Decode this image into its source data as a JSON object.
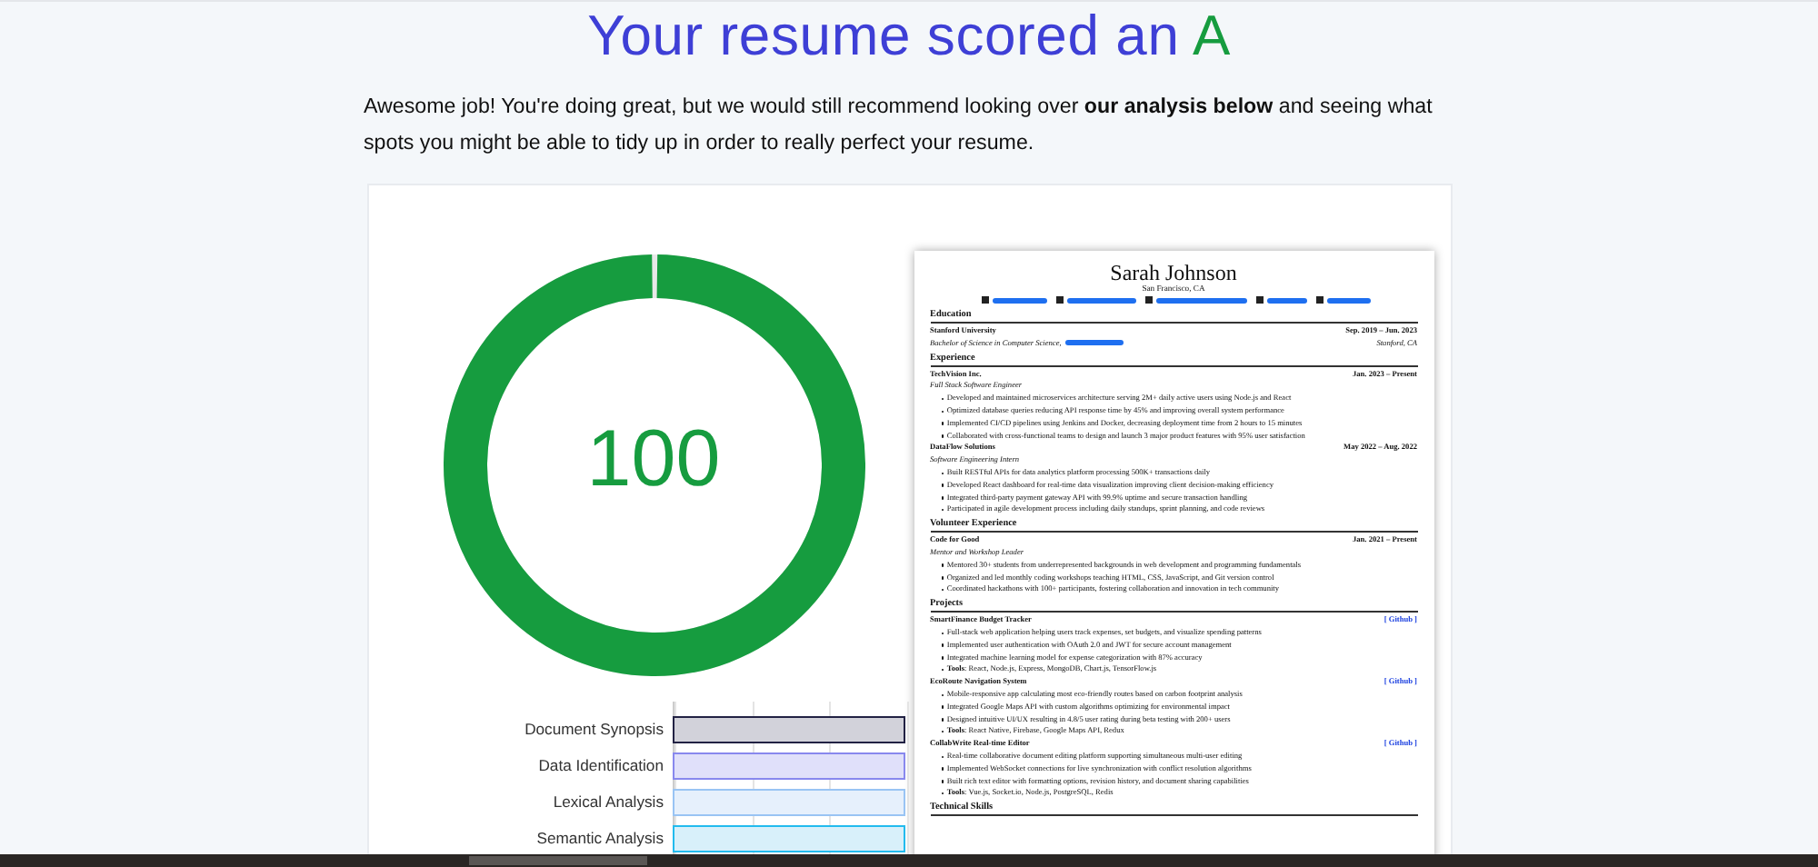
{
  "heading": {
    "text": "Your resume scored an",
    "grade": "A"
  },
  "intro": "Awesome job! You're doing great, but we would still recommend looking over **our analysis below** and seeing what spots you might be able to tidy up in order to really perfect your resume.",
  "score": {
    "value": "100",
    "level": 1
  },
  "analysis": [
    {
      "label": "Document Synopsis",
      "color": "#d2d2da"
    },
    {
      "label": "Data Identification",
      "color": "#e0e0fa"
    },
    {
      "label": "Lexical Analysis",
      "color": "#e6f0fc"
    },
    {
      "label": "Semantic Analysis",
      "color": "#d8f0fa"
    }
  ],
  "resume": {
    "name": "Sarah Johnson",
    "location": "San Francisco, CA",
    "sections": [
      {
        "heading": "Education",
        "entries": [
          {
            "title": "Stanford University",
            "date": "Sep. 2019 – Jun. 2023",
            "subtitle": "Bachelor of Science in Computer Science,",
            "redacted": true,
            "place": "Stanford, CA"
          }
        ]
      },
      {
        "heading": "Experience",
        "entries": [
          {
            "title": "TechVision Inc.",
            "date": "Jan. 2023 – Present",
            "subtitle": "Full Stack Software Engineer",
            "bullets": [
              "Developed and maintained microservices architecture serving 2M+ daily active users using Node.js and React",
              "Optimized database queries reducing API response time by 45% and improving overall system performance",
              "Implemented CI/CD pipelines using Jenkins and Docker, decreasing deployment time from 2 hours to 15 minutes",
              "Collaborated with cross-functional teams to design and launch 3 major product features with 95% user satisfaction"
            ]
          },
          {
            "title": "DataFlow Solutions",
            "date": "May 2022 – Aug. 2022",
            "subtitle": "Software Engineering Intern",
            "bullets": [
              "Built RESTful APIs for data analytics platform processing 500K+ transactions daily",
              "Developed React dashboard for real-time data visualization improving client decision-making efficiency",
              "Integrated third-party payment gateway API with 99.9% uptime and secure transaction handling",
              "Participated in agile development process including daily standups, sprint planning, and code reviews"
            ]
          }
        ]
      },
      {
        "heading": "Volunteer Experience",
        "entries": [
          {
            "title": "Code for Good",
            "date": "Jan. 2021 – Present",
            "subtitle": "Mentor and Workshop Leader",
            "bullets": [
              "Mentored 30+ students from underrepresented backgrounds in web development and programming fundamentals",
              "Organized and led monthly coding workshops teaching HTML, CSS, JavaScript, and Git version control",
              "Coordinated hackathons with 100+ participants, fostering collaboration and innovation in tech community"
            ]
          }
        ]
      },
      {
        "heading": "Projects",
        "entries": [
          {
            "title": "SmartFinance Budget Tracker",
            "link": "[ Github ]",
            "bullets": [
              "Full-stack web application helping users track expenses, set budgets, and visualize spending patterns",
              "Implemented user authentication with OAuth 2.0 and JWT for secure account management",
              "Integrated machine learning model for expense categorization with 87% accuracy",
              "**Tools**: React, Node.js, Express, MongoDB, Chart.js, TensorFlow.js"
            ]
          },
          {
            "title": "EcoRoute Navigation System",
            "link": "[ Github ]",
            "bullets": [
              "Mobile-responsive app calculating most eco-friendly routes based on carbon footprint analysis",
              "Integrated Google Maps API with custom algorithms optimizing for environmental impact",
              "Designed intuitive UI/UX resulting in 4.8/5 user rating during beta testing with 200+ users",
              "**Tools**: React Native, Firebase, Google Maps API, Redux"
            ]
          },
          {
            "title": "CollabWrite Real-time Editor",
            "link": "[ Github ]",
            "bullets": [
              "Real-time collaborative document editing platform supporting simultaneous multi-user editing",
              "Implemented WebSocket connections for live synchronization with conflict resolution algorithms",
              "Built rich text editor with formatting options, revision history, and document sharing capabilities",
              "**Tools**: Vue.js, Socket.io, Node.js, PostgreSQL, Redis"
            ]
          }
        ]
      },
      {
        "heading": "Technical Skills"
      }
    ]
  }
}
